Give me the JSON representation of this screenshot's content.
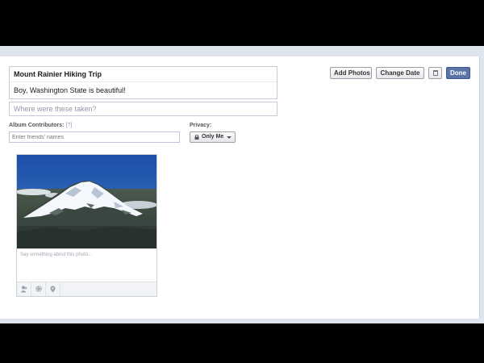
{
  "album": {
    "title": "Mount Rainier Hiking Trip",
    "description": "Boy, Washington State is beautiful!",
    "location_placeholder": "Where were these taken?",
    "location_value": ""
  },
  "toolbar": {
    "add_photos_label": "Add Photos",
    "change_date_label": "Change Date",
    "delete_icon": "trash-icon",
    "done_label": "Done",
    "done_color": "#5b74a8"
  },
  "contributors": {
    "label": "Album Contributors:",
    "help": "[?]",
    "placeholder": "Enter friends' names"
  },
  "privacy": {
    "label": "Privacy:",
    "value": "Only Me",
    "icon": "lock-icon"
  },
  "photo": {
    "subject": "snow-capped-mountain-photo",
    "caption_placeholder": "Say something about this photo...",
    "tools": [
      "tag-person-icon",
      "gear-icon",
      "location-pin-icon"
    ]
  }
}
